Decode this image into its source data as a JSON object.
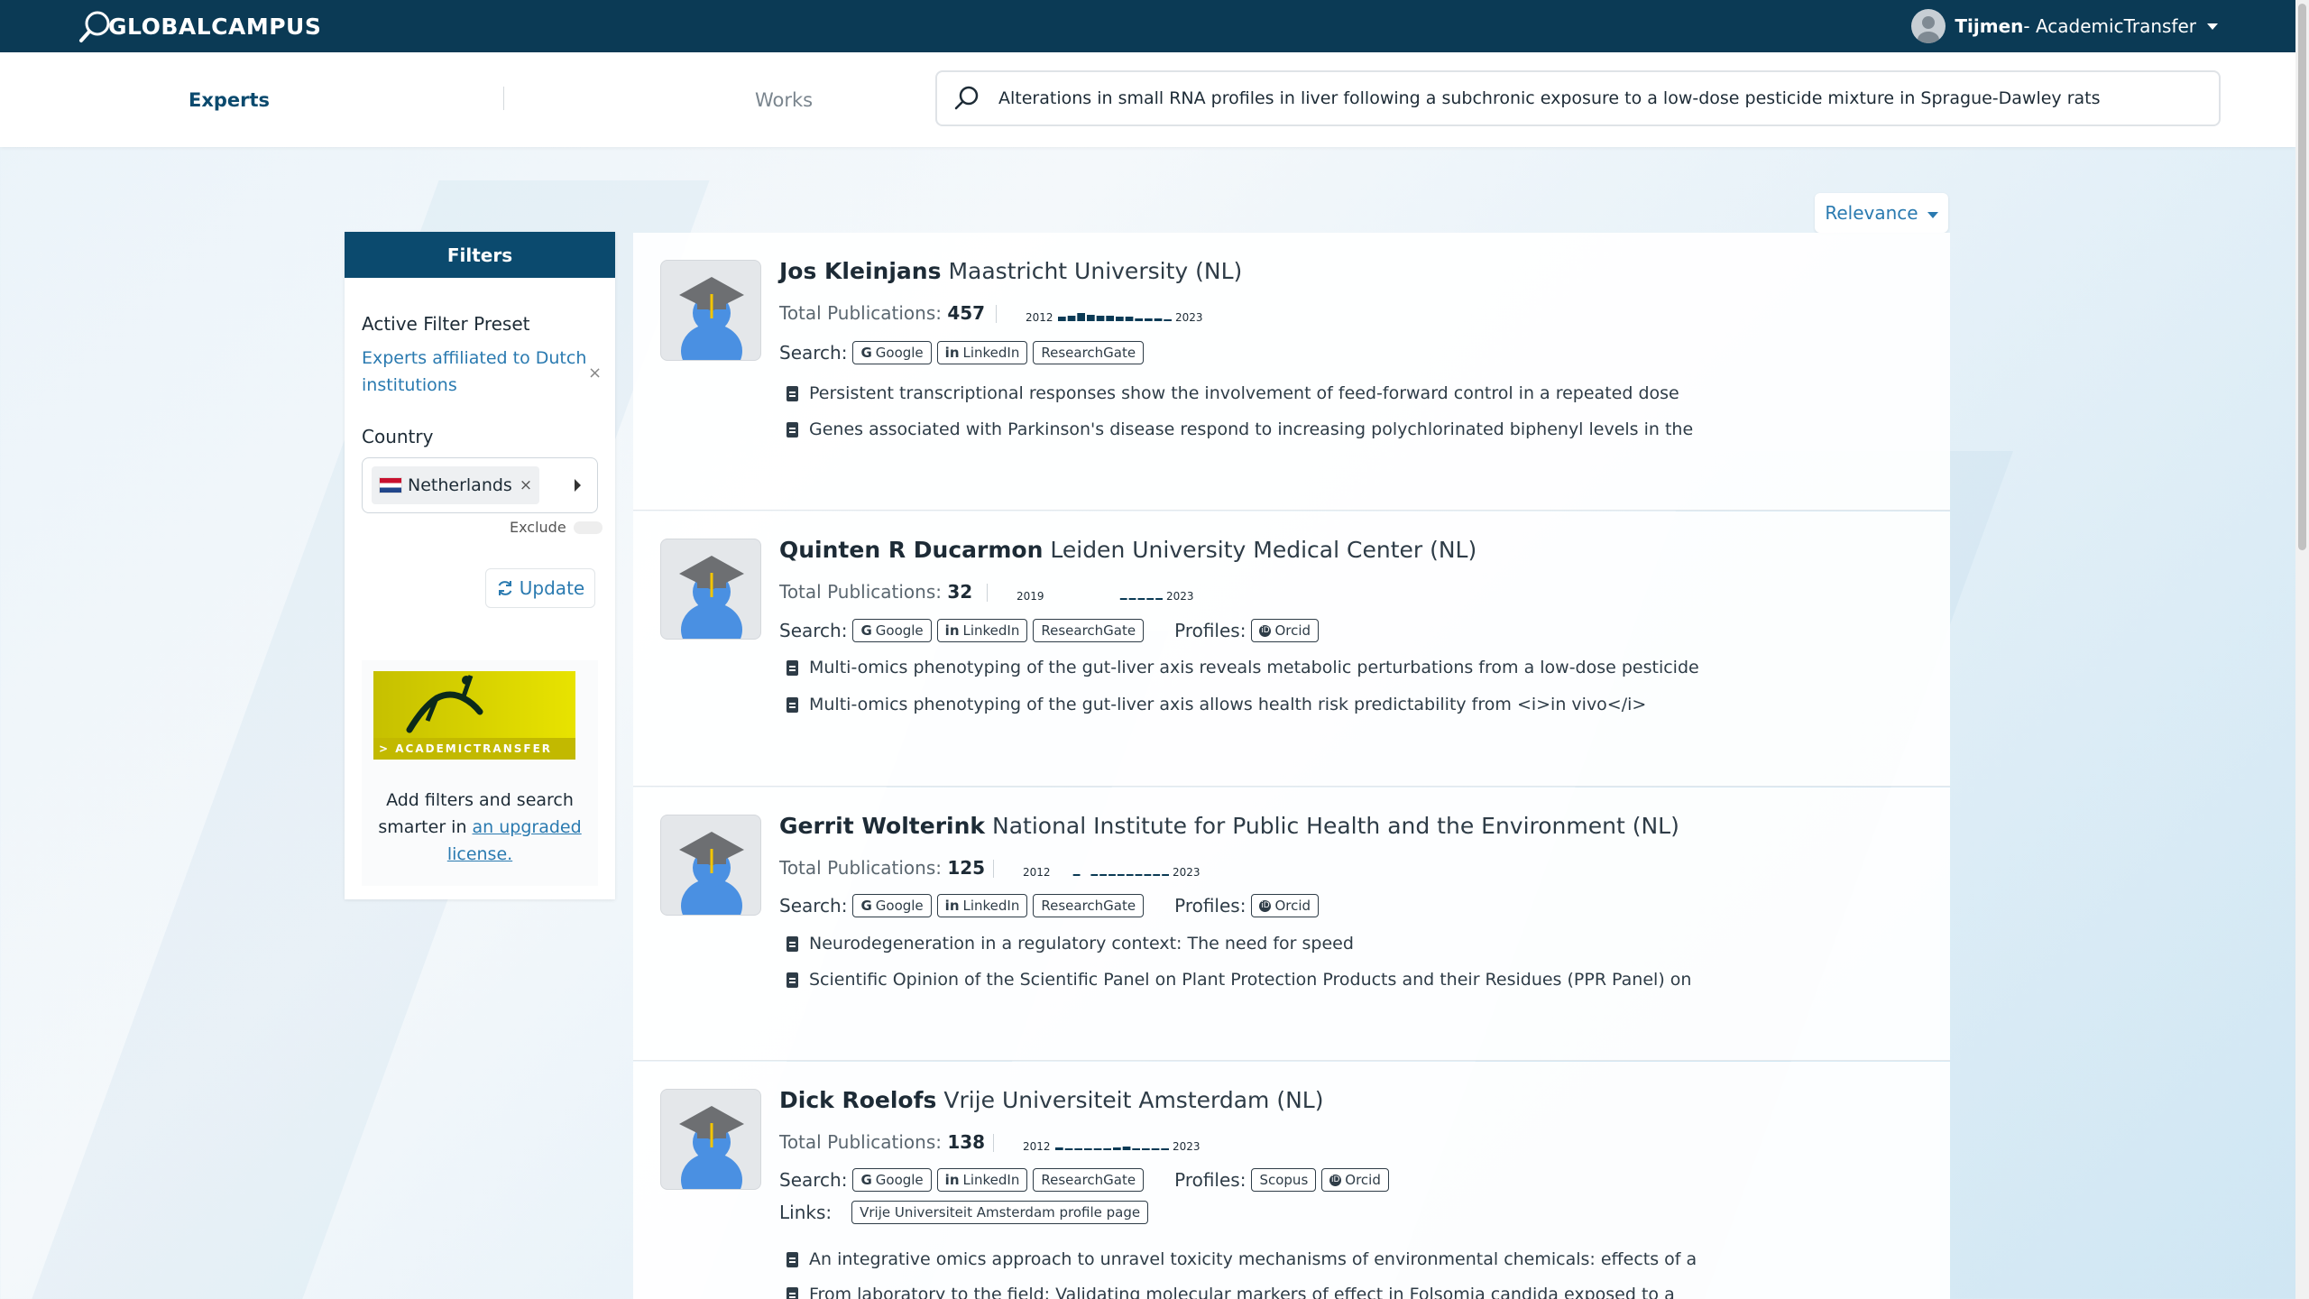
{
  "nav": {
    "logo_text": "LOBALCAMPUS",
    "logo_prefix": "G",
    "user_name": "Tijmen",
    "user_org": " - AcademicTransfer"
  },
  "tabs": {
    "experts": "Experts",
    "works": "Works"
  },
  "search": {
    "value": "Alterations in small RNA profiles in liver following a subchronic exposure to a low-dose pesticide mixture in Sprague-Dawley rats"
  },
  "filters": {
    "title": "Filters",
    "preset_label": "Active Filter Preset",
    "preset_value": "Experts affiliated to Dutch institutions",
    "remove_glyph": "×",
    "country_label": "Country",
    "country_value": "Netherlands",
    "exclude_label": "Exclude",
    "update_label": "Update",
    "promo_bar": "> ACADEMICTRANSFER",
    "promo_text_1": "Add filters and search smarter in ",
    "promo_link": "an upgraded license."
  },
  "sort": {
    "label": "Relevance"
  },
  "labels": {
    "total_pubs": "Total Publications: ",
    "search": "Search:",
    "profiles": "Profiles:",
    "links": "Links:",
    "google": "Google",
    "linkedin": "LinkedIn",
    "researchgate": "ResearchGate",
    "orcid": "Orcid",
    "scopus": "Scopus"
  },
  "experts": [
    {
      "name": "Jos Kleinjans",
      "affiliation": "Maastricht University (NL)",
      "total": "457",
      "year_start": "2012",
      "year_end": "2023",
      "activity": [
        0.5,
        0.6,
        0.9,
        0.7,
        0.6,
        0.55,
        0.5,
        0.45,
        0.3,
        0.3,
        0.25,
        0.2
      ],
      "works": [
        "Persistent transcriptional responses show the involvement of feed-forward control in a repeated dose",
        "Genes associated with Parkinson's disease respond to increasing polychlorinated biphenyl levels in the"
      ]
    },
    {
      "name": "Quinten R Ducarmon",
      "affiliation": "Leiden University Medical Center (NL)",
      "total": "32",
      "year_start": "2019",
      "year_end": "2023",
      "activity": [
        0,
        0,
        0,
        0,
        0,
        0,
        0,
        0,
        0.15,
        0.15,
        0.15,
        0.15,
        0.15
      ],
      "works": [
        "Multi-omics phenotyping of the gut-liver axis reveals metabolic perturbations from a low-dose pesticide",
        "Multi-omics phenotyping of the gut-liver axis allows health risk predictability from <i>in vivo</i>"
      ]
    },
    {
      "name": "Gerrit Wolterink",
      "affiliation": "National Institute for Public Health and the Environment (NL)",
      "total": "125",
      "year_start": "2012",
      "year_end": "2023",
      "activity": [
        0,
        0,
        0.1,
        0,
        0.1,
        0.15,
        0.2,
        0.2,
        0.2,
        0.2,
        0.2,
        0.15,
        0.1
      ],
      "works": [
        "Neurodegeneration in a regulatory context: The need for speed",
        "Scientific Opinion of the Scientific Panel on Plant Protection Products and their Residues (PPR Panel) on"
      ]
    },
    {
      "name": "Dick Roelofs",
      "affiliation": "Vrije Universiteit Amsterdam (NL)",
      "total": "138",
      "year_start": "2012",
      "year_end": "2023",
      "activity": [
        0.3,
        0.2,
        0.2,
        0.2,
        0.2,
        0.15,
        0.25,
        0.35,
        0.2,
        0.1,
        0.1,
        0.1
      ],
      "link": "Vrije Universiteit Amsterdam profile page",
      "works": [
        "An integrative omics approach to unravel toxicity mechanisms of environmental chemicals: effects of a",
        "From laboratory to the field: Validating molecular markers of effect in Folsomia candida exposed to a"
      ]
    }
  ]
}
